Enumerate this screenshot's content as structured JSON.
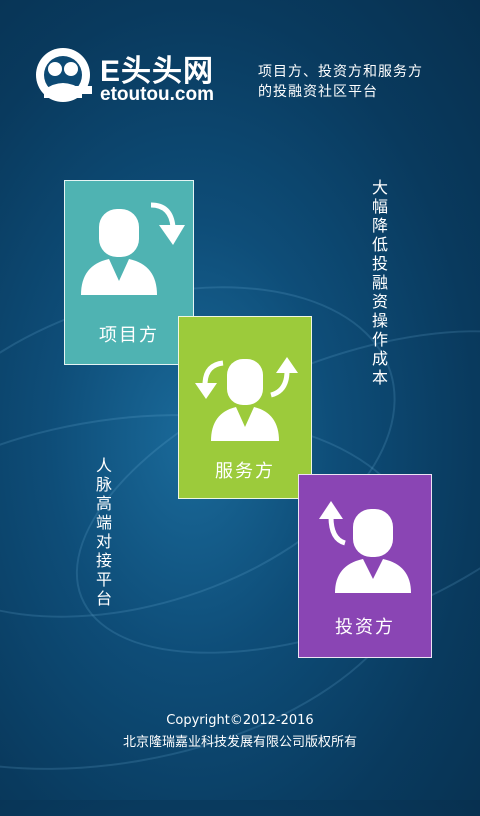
{
  "brand": {
    "name": "E头头网",
    "domain": "etoutou.com"
  },
  "tagline": {
    "line1": "项目方、投资方和服务方",
    "line2": "的投融资社区平台"
  },
  "cards": {
    "project": {
      "label": "项目方",
      "color": "#4fb3b2"
    },
    "service": {
      "label": "服务方",
      "color": "#9ccb3b"
    },
    "investor": {
      "label": "投资方",
      "color": "#8a45b4"
    }
  },
  "vertical": {
    "right": "大幅降低投融资操作成本",
    "left": "人脉高端对接平台"
  },
  "footer": {
    "copyright": "Copyright©2012-2016",
    "company": "北京隆瑞嘉业科技发展有限公司版权所有"
  },
  "icons": [
    "logo-icon",
    "person-icon",
    "arrow-icon"
  ]
}
